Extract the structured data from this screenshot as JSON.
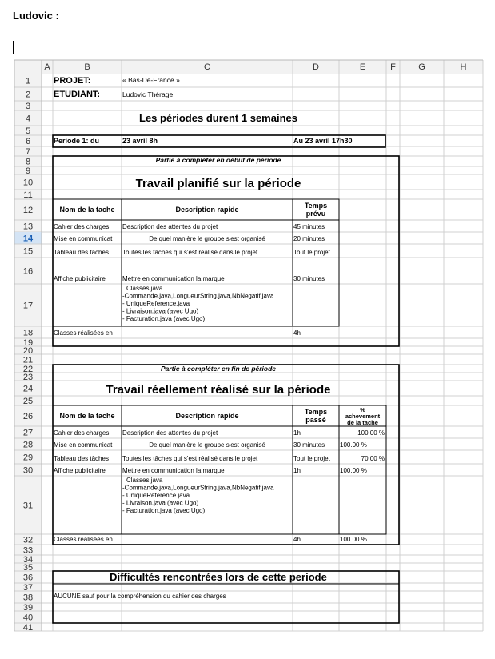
{
  "document": {
    "author_label": "Ludovic :"
  },
  "sheet": {
    "columns": [
      "A",
      "B",
      "C",
      "D",
      "E",
      "F",
      "G",
      "H"
    ],
    "rows": [
      "1",
      "2",
      "3",
      "4",
      "5",
      "6",
      "7",
      "8",
      "9",
      "10",
      "11",
      "12",
      "13",
      "14",
      "15",
      "16",
      "17",
      "18",
      "19",
      "20",
      "21",
      "22",
      "23",
      "24",
      "25",
      "26",
      "27",
      "28",
      "29",
      "30",
      "31",
      "32",
      "33",
      "34",
      "35",
      "36",
      "37",
      "38",
      "39",
      "40",
      "41"
    ],
    "selected_row": "14"
  },
  "header": {
    "projet_label": "PROJET:",
    "projet_value": "« Bas-De-France »",
    "etudiant_label": "ETUDIANT:",
    "etudiant_value": "Ludovic Thérage",
    "periods_title": "Les périodes durent 1 semaines",
    "periode_label": "Periode 1: du",
    "periode_start": "23 avril 8h",
    "periode_end": "Au 23 avril 17h30"
  },
  "planned": {
    "note": "Partie à compléter en début de période",
    "title": "Travail planifié sur la période",
    "columns": [
      "Nom de la tache",
      "Description rapide",
      "Temps prévu"
    ],
    "rows": [
      {
        "name": "Cahier des charges",
        "desc": "Description des attentes du projet",
        "time": "45 minutes"
      },
      {
        "name": "Mise en communicat",
        "desc": "De quel manière le groupe s'est organisé",
        "time": "20 minutes"
      },
      {
        "name": "Tableau des tâches",
        "desc": "Toutes les tâches qui s'est réalisé dans le projet",
        "time": "Tout le projet"
      },
      {
        "name": "Affiche publicitaire",
        "desc": "Mettre en communication la marque",
        "time": "30 minutes"
      },
      {
        "name": "Classes réalisées en",
        "desc_lines": [
          "Classes java",
          "-Commande.java,LongueurString.java,NbNegatif.java",
          "- UniqueReference.java",
          "- Livraison.java (avec Ugo)",
          "- Facturation.java (avec Ugo)"
        ],
        "time": "4h"
      }
    ]
  },
  "done": {
    "note": "Partie à compléter en fin de période",
    "title": "Travail réellement réalisé sur la période",
    "columns": [
      "Nom de la tache",
      "Description rapide",
      "Temps passé",
      "% achevement de la tache"
    ],
    "rows": [
      {
        "name": "Cahier des charges",
        "desc": "Description des attentes du projet",
        "time": "1h",
        "pct": "100,00 %"
      },
      {
        "name": "Mise en communicat",
        "desc": "De quel manière le groupe s'est organisé",
        "time": "30 minutes",
        "pct": "100.00 %"
      },
      {
        "name": "Tableau des tâches",
        "desc": "Toutes les tâches qui s'est réalisé dans le projet",
        "time": "Tout le projet",
        "pct": "70,00 %"
      },
      {
        "name": "Affiche publicitaire",
        "desc": "Mettre en communication la marque",
        "time": "1h",
        "pct": "100.00 %"
      },
      {
        "name": "Classes réalisées en",
        "desc_lines": [
          "Classes java",
          "-Commande.java,LongueurString.java,NbNegatif.java",
          "- UniqueReference.java",
          "- Livraison.java (avec Ugo)",
          "- Facturation.java (avec Ugo)"
        ],
        "time": "4h",
        "pct": "100.00 %"
      }
    ]
  },
  "difficulties": {
    "title": "Difficultés rencontrées lors de cette periode",
    "text": "AUCUNE sauf pour la compréhension du cahier des charges"
  },
  "colors": {
    "note_red": "#e00000",
    "selected_row_header": "#d4e4f5",
    "selected_row_text": "#1a5fb4"
  }
}
